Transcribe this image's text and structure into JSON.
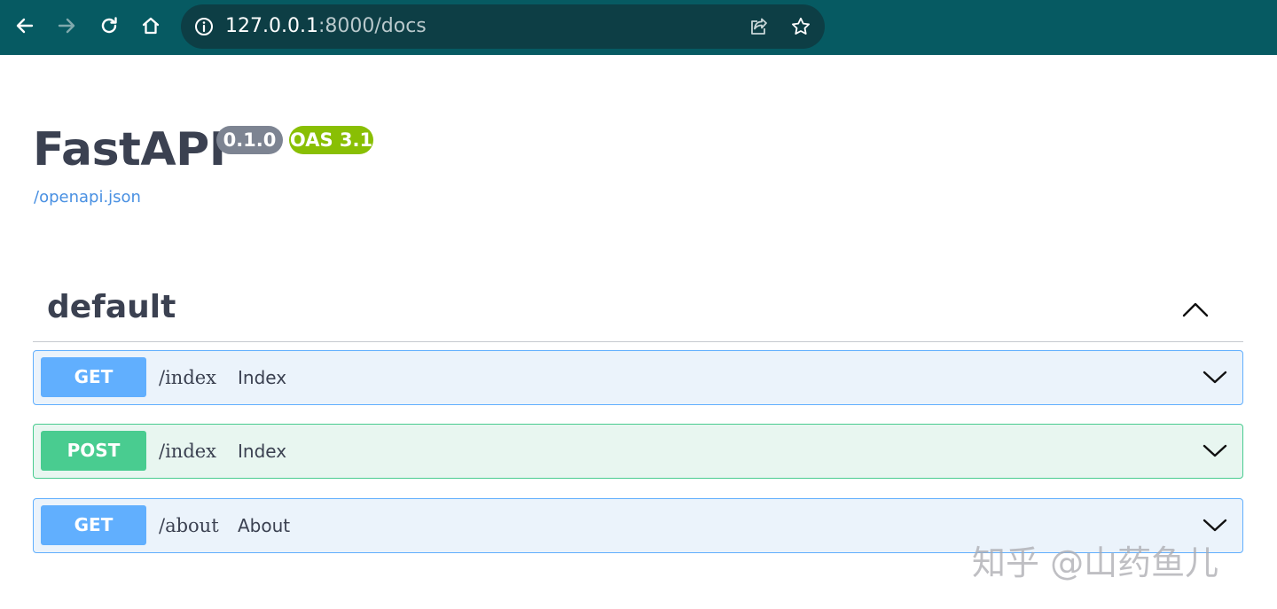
{
  "browser": {
    "url_host": "127.0.0.1",
    "url_path": ":8000/docs",
    "colors": {
      "toolbar": "#065a62",
      "omnibox": "#0d3e45"
    }
  },
  "api": {
    "title": "FastAPI",
    "version": "0.1.0",
    "oas": "OAS 3.1",
    "spec_link": "/openapi.json"
  },
  "tag": {
    "name": "default",
    "expanded": true
  },
  "operations": [
    {
      "method": "GET",
      "path": "/index",
      "summary": "Index"
    },
    {
      "method": "POST",
      "path": "/index",
      "summary": "Index"
    },
    {
      "method": "GET",
      "path": "/about",
      "summary": "About"
    }
  ],
  "watermark": "知乎 @山药鱼儿",
  "colors": {
    "get": "#61affe",
    "post": "#49cc90",
    "version_badge": "#7d8492",
    "oas_badge": "#89bf04",
    "link": "#4990e2"
  }
}
